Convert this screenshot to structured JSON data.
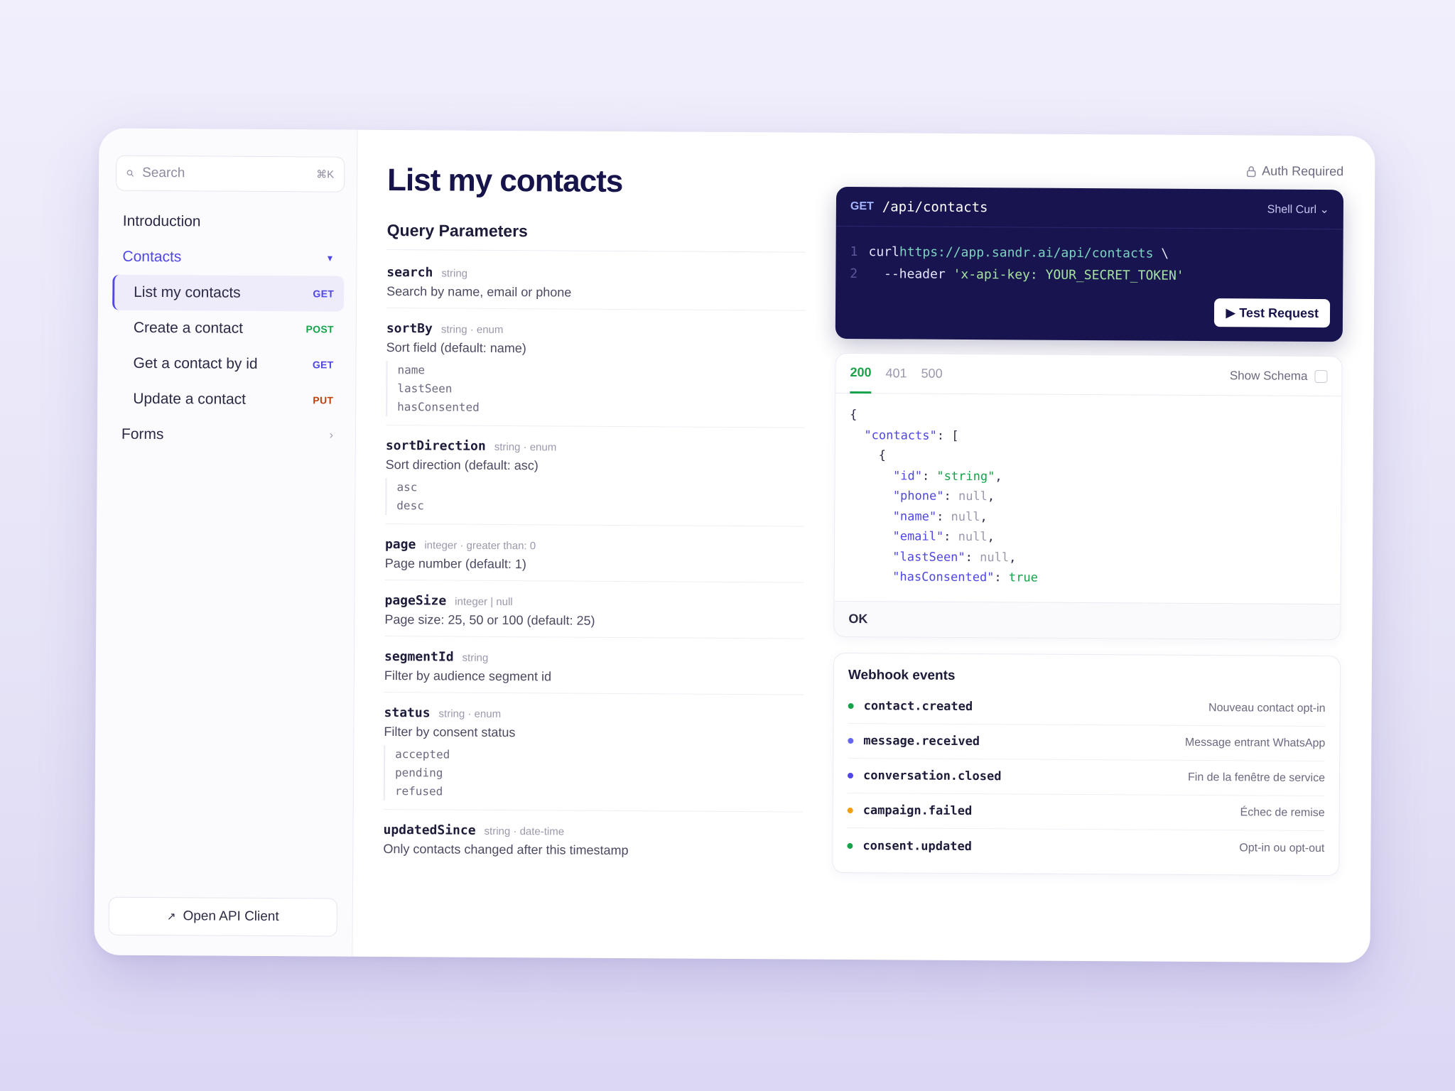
{
  "search": {
    "placeholder": "Search",
    "shortcut": "⌘K"
  },
  "sidebar": {
    "items": [
      {
        "label": "Introduction"
      },
      {
        "label": "Contacts"
      },
      {
        "label": "Forms"
      }
    ],
    "contacts_children": [
      {
        "label": "List my contacts",
        "method": "GET"
      },
      {
        "label": "Create a contact",
        "method": "POST"
      },
      {
        "label": "Get a contact by id",
        "method": "GET"
      },
      {
        "label": "Update a contact",
        "method": "PUT"
      }
    ],
    "open_client": "Open API Client"
  },
  "main": {
    "title": "List my contacts",
    "params_title": "Query Parameters",
    "params": [
      {
        "name": "search",
        "type": "string",
        "desc": "Search by name, email or phone",
        "enum": []
      },
      {
        "name": "sortBy",
        "type": "string · enum",
        "desc": "Sort field (default: name)",
        "enum": [
          "name",
          "lastSeen",
          "hasConsented"
        ]
      },
      {
        "name": "sortDirection",
        "type": "string · enum",
        "desc": "Sort direction (default: asc)",
        "enum": [
          "asc",
          "desc"
        ]
      },
      {
        "name": "page",
        "type": "integer · greater than: 0",
        "desc": "Page number (default: 1)",
        "enum": []
      },
      {
        "name": "pageSize",
        "type": "integer | null",
        "desc": "Page size: 25, 50 or 100 (default: 25)",
        "enum": []
      },
      {
        "name": "segmentId",
        "type": "string",
        "desc": "Filter by audience segment id",
        "enum": []
      },
      {
        "name": "status",
        "type": "string · enum",
        "desc": "Filter by consent status",
        "enum": [
          "accepted",
          "pending",
          "refused"
        ]
      },
      {
        "name": "updatedSince",
        "type": "string · date-time",
        "desc": "Only contacts changed after this timestamp",
        "enum": []
      }
    ]
  },
  "request": {
    "auth": "Auth Required",
    "method": "GET",
    "path": "/api/contacts",
    "lang": "Shell Curl ⌄",
    "line1_cmd": "curl ",
    "line1_url": "https://app.sandr.ai/api/contacts",
    "line1_tail": " \\",
    "line2_flag": "  --header ",
    "line2_str": "'x-api-key: YOUR_SECRET_TOKEN'",
    "test_button": "▶ Test Request"
  },
  "response": {
    "tabs": [
      "200",
      "401",
      "500"
    ],
    "show_schema": "Show Schema",
    "status_text": "OK",
    "fields": [
      {
        "key": "\"id\"",
        "value": "\"string\"",
        "kind": "str"
      },
      {
        "key": "\"phone\"",
        "value": "null",
        "kind": "null"
      },
      {
        "key": "\"name\"",
        "value": "null",
        "kind": "null"
      },
      {
        "key": "\"email\"",
        "value": "null",
        "kind": "null"
      },
      {
        "key": "\"lastSeen\"",
        "value": "null",
        "kind": "null"
      },
      {
        "key": "\"hasConsented\"",
        "value": "true",
        "kind": "str"
      }
    ],
    "root_key": "\"contacts\""
  },
  "webhooks": {
    "title": "Webhook events",
    "events": [
      {
        "name": "contact.created",
        "desc": "Nouveau contact opt-in",
        "color": "#16a34a"
      },
      {
        "name": "message.received",
        "desc": "Message entrant WhatsApp",
        "color": "#6366f1"
      },
      {
        "name": "conversation.closed",
        "desc": "Fin de la fenêtre de service",
        "color": "#4f46e5"
      },
      {
        "name": "campaign.failed",
        "desc": "Échec de remise",
        "color": "#f59e0b"
      },
      {
        "name": "consent.updated",
        "desc": "Opt-in ou opt-out",
        "color": "#16a34a"
      }
    ]
  }
}
